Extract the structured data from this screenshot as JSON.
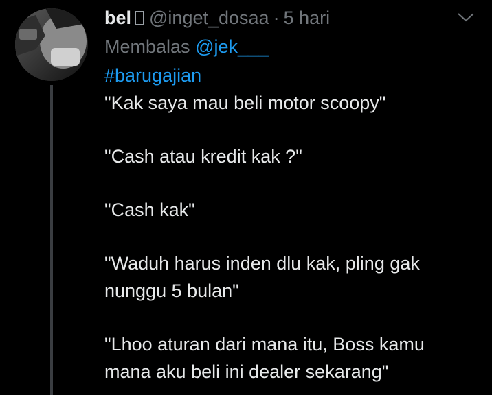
{
  "author": {
    "name": "bel",
    "handle": "@inget_dosaa",
    "separator": "·",
    "time": "5 hari"
  },
  "reply": {
    "prefix": "Membalas",
    "mention": "@jek___"
  },
  "tweet": {
    "hashtag": "#barugajian",
    "lines": [
      "\"Kak saya mau beli motor scoopy\"",
      "\"Cash atau kredit kak ?\"",
      "\"Cash kak\"",
      "\"Waduh harus inden dlu kak, pling gak",
      "nunggu 5 bulan\"",
      "\"Lhoo aturan dari mana itu, Boss kamu",
      "mana aku beli ini dealer sekarang\""
    ]
  },
  "icons": {
    "more": "chevron-down-icon",
    "badge": "emoji-placeholder-icon"
  },
  "colors": {
    "background": "#000000",
    "text": "#e7e9ea",
    "muted": "#71767b",
    "link": "#1d9bf0",
    "thread_line": "#3a3d41"
  }
}
